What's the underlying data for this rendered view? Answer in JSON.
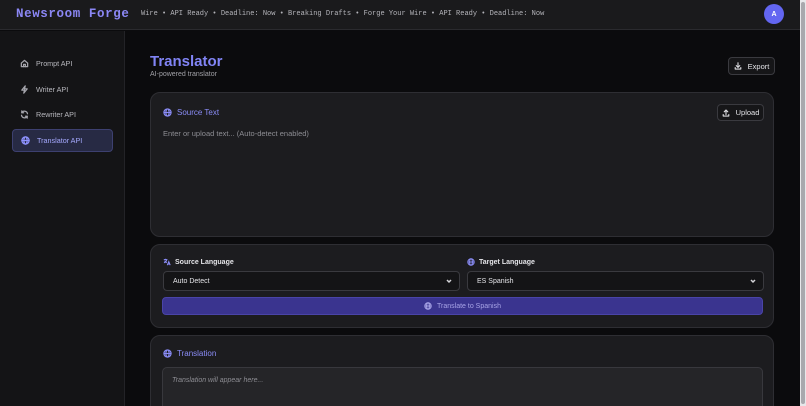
{
  "header": {
    "brand": "Newsroom Forge",
    "ticker": "Wire • API Ready • Deadline: Now • Breaking Drafts • Forge Your Wire • API Ready • Deadline: Now",
    "avatar_initial": "A"
  },
  "sidebar": {
    "items": [
      {
        "label": "Prompt API",
        "icon": "home-icon",
        "active": false
      },
      {
        "label": "Writer API",
        "icon": "bolt-icon",
        "active": false
      },
      {
        "label": "Rewriter API",
        "icon": "refresh-icon",
        "active": false
      },
      {
        "label": "Translator API",
        "icon": "globe-icon",
        "active": true
      }
    ]
  },
  "page": {
    "title": "Translator",
    "subtitle": "AI-powered translator",
    "export_label": "Export"
  },
  "source": {
    "heading": "Source Text",
    "upload_label": "Upload",
    "placeholder": "Enter or upload text... (Auto-detect enabled)"
  },
  "languages": {
    "source_label": "Source Language",
    "source_value": "Auto Detect",
    "target_label": "Target Language",
    "target_value": "ES Spanish",
    "translate_label": "Translate to Spanish"
  },
  "translation": {
    "heading": "Translation",
    "placeholder": "Translation will appear here..."
  },
  "colors": {
    "accent": "#8184f5",
    "primary_button": "#3a348f",
    "background": "#0b0b0d",
    "card": "#1c1c1f"
  }
}
